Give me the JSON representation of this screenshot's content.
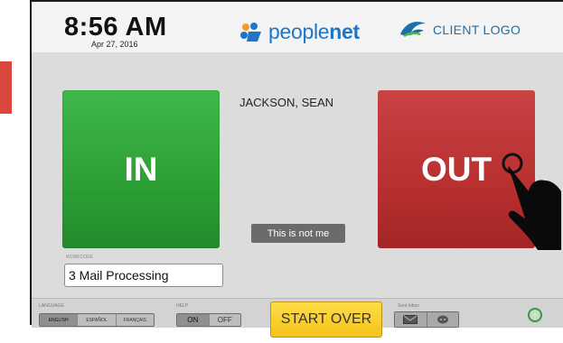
{
  "header": {
    "time": "8:56 AM",
    "date": "Apr 27, 2016",
    "brand_prefix": "people",
    "brand_suffix": "net",
    "client_logo_text": "CLIENT LOGO"
  },
  "punch": {
    "in_label": "IN",
    "out_label": "OUT",
    "employee_name": "JACKSON, SEAN",
    "not_me_label": "This is not me"
  },
  "workcode": {
    "label": "WORKCODE",
    "value": "3 Mail Processing"
  },
  "footer": {
    "language_label": "LANGUAGE",
    "languages": [
      "ENGLISH",
      "ESPAÑOL",
      "FRANÇAIS"
    ],
    "help_label": "HELP",
    "help_on": "ON",
    "help_off": "OFF",
    "start_over_label": "START OVER",
    "messages_label": "Sent Inbox"
  },
  "colors": {
    "in_green": "#2c9f35",
    "out_red": "#b8302f",
    "start_over_yellow": "#f4c21b",
    "brand_blue": "#1f76c9"
  },
  "icons": {
    "brand": "peoplenet-logo-icon",
    "client": "client-bird-logo-icon",
    "mail": "envelope-icon",
    "message": "chat-bubble-icon",
    "status": "status-ring-icon",
    "touch": "pointing-hand-icon"
  }
}
